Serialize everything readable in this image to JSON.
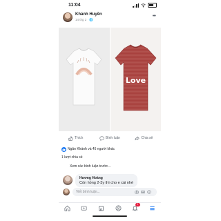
{
  "status": {
    "time": "11:04"
  },
  "post": {
    "author": "Khánh Huyền",
    "meta": "14 thg 2 · 🌐",
    "more": "•••",
    "shirt_text": "Love"
  },
  "actions": {
    "like": "Thích",
    "comment": "Bình luận",
    "share": "Chia sẻ"
  },
  "reactions": {
    "text": "Ngân Khánh và 45 người khác"
  },
  "shares": {
    "text": "1 lượt chia sẻ"
  },
  "comments": {
    "prev_link": "Xem các bình luận trước...",
    "items": [
      {
        "name": "Hương Hoàng",
        "text": "Còn hồng 2-3y thì cho e cái nhé"
      }
    ]
  },
  "composer": {
    "placeholder": "Viết bình luận..."
  },
  "tabbar": {
    "notif_badge": "1"
  },
  "colors": {
    "accent": "#1877f2",
    "shirt_red": "#a8413e",
    "badge": "#e41e3f"
  },
  "icons": [
    "signal-icon",
    "wifi-icon",
    "battery-icon",
    "like-icon",
    "comment-icon",
    "share-icon",
    "globe-icon",
    "home-icon",
    "video-icon",
    "marketplace-icon",
    "groups-icon",
    "bell-icon",
    "menu-icon",
    "camera-icon",
    "gif-icon",
    "sticker-icon"
  ]
}
